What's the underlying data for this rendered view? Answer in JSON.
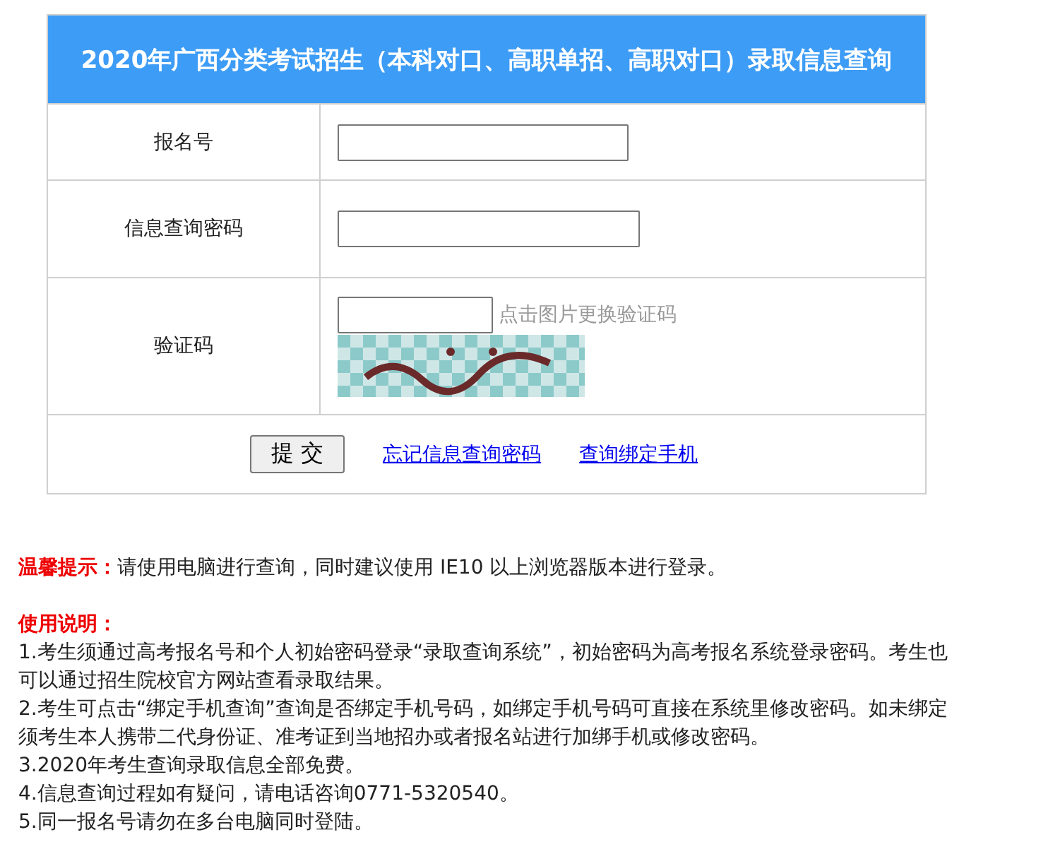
{
  "title": "2020年广西分类考试招生（本科对口、高职单招、高职对口）录取信息查询",
  "fields": [
    {
      "label": "报名号",
      "kind": "text"
    },
    {
      "label": "信息查询密码",
      "kind": "password"
    },
    {
      "label": "验证码",
      "kind": "captcha",
      "hint": "点击图片更换验证码"
    }
  ],
  "actions": {
    "submit": "提 交",
    "links": [
      "忘记信息查询密码",
      "查询绑定手机"
    ]
  },
  "tip": {
    "label": "温馨提示：",
    "text": "请使用电脑进行查询，同时建议使用 IE10 以上浏览器版本进行登录。"
  },
  "instructions": {
    "heading": "使用说明：",
    "items": [
      "1.考生须通过高考报名号和个人初始密码登录“录取查询系统”，初始密码为高考报名系统登录密码。考生也可以通过招生院校官方网站查看录取结果。",
      "2.考生可点击“绑定手机查询”查询是否绑定手机号码，如绑定手机号码可直接在系统里修改密码。如未绑定须考生本人携带二代身份证、准考证到当地招办或者报名站进行加绑手机或修改密码。",
      "3.2020年考生查询录取信息全部免费。",
      "4.信息查询过程如有疑问，请电话咨询0771-5320540。",
      "5.同一报名号请勿在多台电脑同时登陆。"
    ]
  }
}
